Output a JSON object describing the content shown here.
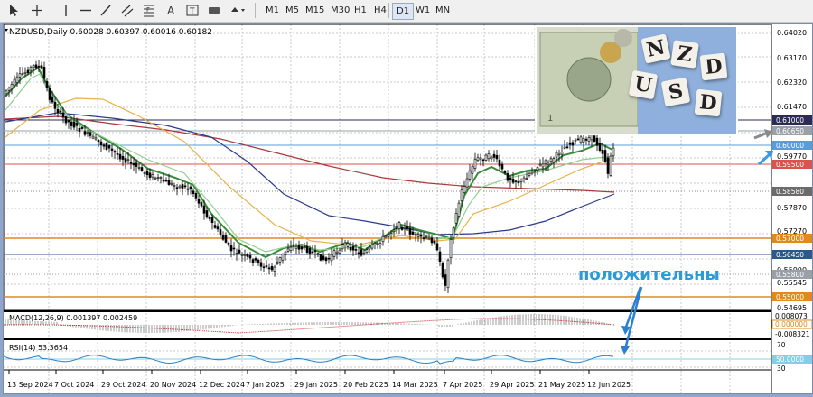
{
  "toolbar": {
    "timeframes": [
      "M1",
      "M5",
      "M15",
      "M30",
      "H1",
      "H4",
      "D1",
      "W1",
      "MN"
    ],
    "active_timeframe": "D1"
  },
  "chart": {
    "header": "NZDUSD,Daily  0.60028 0.60397 0.60016 0.60182",
    "macd_label": "MACD(12,26,9) 0.001397 0.002459",
    "rsi_label": "RSI(14) 53.3654",
    "annotation": "положительны",
    "price_scale": [
      "0.64020",
      "0.63170",
      "0.62320",
      "0.61470",
      "0.60650",
      "0.59770",
      "0.58580",
      "0.57870",
      "0.57270",
      "0.56450",
      "0.55990",
      "0.55545",
      "0.55000",
      "0.54695"
    ],
    "price_badges": [
      {
        "text": "0.61000",
        "color": "#2b2b55"
      },
      {
        "text": "0.60650",
        "color": "#9aa0a8"
      },
      {
        "text": "0.60000",
        "color": "#5a9bd8"
      },
      {
        "text": "0.59500",
        "color": "#d9534f"
      },
      {
        "text": "0.58580",
        "color": "#6b6b6b"
      },
      {
        "text": "0.57000",
        "color": "#e08a1e"
      },
      {
        "text": "0.56450",
        "color": "#2b5a8a"
      },
      {
        "text": "0.55800",
        "color": "#9aa0a8"
      },
      {
        "text": "0.55000",
        "color": "#e08a1e"
      }
    ],
    "macd_scale": [
      "0.008073",
      "0.000000",
      "-0.008321"
    ],
    "rsi_scale": [
      "70",
      "50.0000",
      "30"
    ],
    "dates": [
      "13 Sep 2024",
      "7 Oct 2024",
      "29 Oct 2024",
      "20 Nov 2024",
      "12 Dec 2024",
      "7 Jan 2025",
      "29 Jan 2025",
      "20 Feb 2025",
      "14 Mar 2025",
      "7 Apr 2025",
      "29 Apr 2025",
      "21 May 2025",
      "12 Jun 2025"
    ],
    "photo_letters": [
      "N",
      "Z",
      "D",
      "U",
      "S",
      "D"
    ]
  }
}
